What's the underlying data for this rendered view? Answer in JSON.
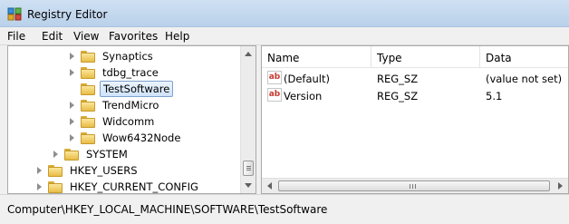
{
  "window": {
    "title": "Registry Editor",
    "icon": "registry-editor-icon"
  },
  "menu": [
    "File",
    "Edit",
    "View",
    "Favorites",
    "Help"
  ],
  "tree": [
    {
      "label": "Synaptics",
      "expandable": true,
      "selected": false
    },
    {
      "label": "tdbg_trace",
      "expandable": true,
      "selected": false
    },
    {
      "label": "TestSoftware",
      "expandable": false,
      "selected": true
    },
    {
      "label": "TrendMicro",
      "expandable": true,
      "selected": false
    },
    {
      "label": "Widcomm",
      "expandable": true,
      "selected": false
    },
    {
      "label": "Wow6432Node",
      "expandable": true,
      "selected": false
    },
    {
      "label": "SYSTEM",
      "expandable": true,
      "selected": false
    },
    {
      "label": "HKEY_USERS",
      "expandable": true,
      "selected": false
    },
    {
      "label": "HKEY_CURRENT_CONFIG",
      "expandable": true,
      "selected": false
    }
  ],
  "list": {
    "columns": [
      "Name",
      "Type",
      "Data"
    ],
    "rows": [
      {
        "icon": "ab-string-icon",
        "name": "(Default)",
        "type": "REG_SZ",
        "data": "(value not set)"
      },
      {
        "icon": "ab-string-icon",
        "name": "Version",
        "type": "REG_SZ",
        "data": "5.1"
      }
    ]
  },
  "status": {
    "path": "Computer\\HKEY_LOCAL_MACHINE\\SOFTWARE\\TestSoftware"
  },
  "colors": {
    "selection_border": "#7da2ce",
    "folder": "#e8bd46",
    "string_icon": "#c8372d"
  }
}
